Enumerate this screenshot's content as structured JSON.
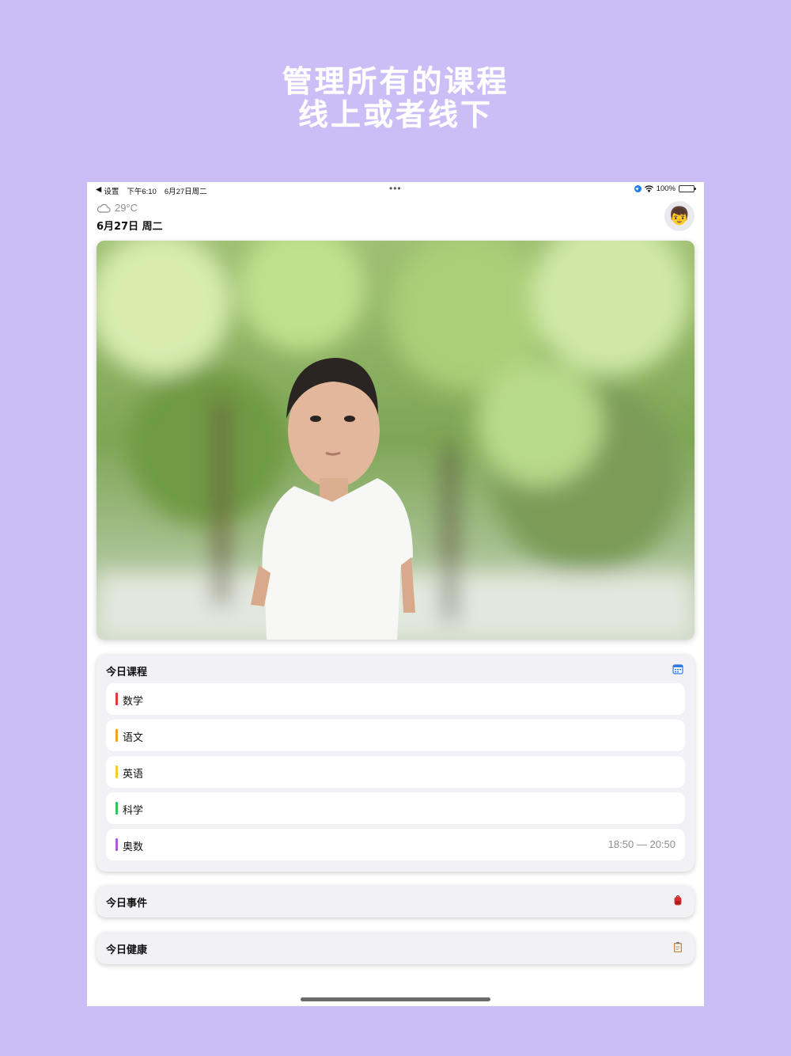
{
  "headline": {
    "line1": "管理所有的课程",
    "line2": "线上或者线下"
  },
  "status_bar": {
    "back_label": "设置",
    "time": "下午6:10",
    "date": "6月27日周二",
    "battery": "100%"
  },
  "header": {
    "temperature": "29°C",
    "weather_icon": "cloud-icon",
    "date": "6月27日 周二",
    "avatar_icon": "child-face-icon"
  },
  "courses_card": {
    "title": "今日课程",
    "icon": "calendar-icon",
    "items": [
      {
        "name": "数学",
        "color": "#e03a3a",
        "time": ""
      },
      {
        "name": "语文",
        "color": "#f0a51e",
        "time": ""
      },
      {
        "name": "英语",
        "color": "#f3cc2e",
        "time": ""
      },
      {
        "name": "科学",
        "color": "#35c25b",
        "time": ""
      },
      {
        "name": "奥数",
        "color": "#b05ad9",
        "time": "18:50 — 20:50"
      }
    ]
  },
  "events_card": {
    "title": "今日事件",
    "icon": "backpack-icon"
  },
  "health_card": {
    "title": "今日健康",
    "icon": "clipboard-icon"
  }
}
